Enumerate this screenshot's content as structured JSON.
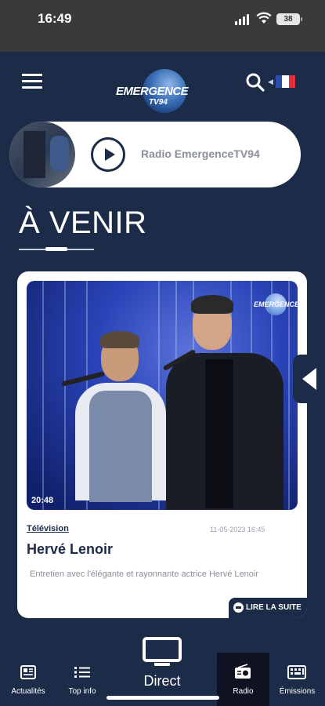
{
  "status_bar": {
    "time": "16:49",
    "battery": "38"
  },
  "header": {
    "logo_text": "EMERGENCE",
    "logo_sub": "TV94",
    "language_flag": "fr"
  },
  "radio": {
    "title": "Radio EmergenceTV94"
  },
  "section": {
    "title": "À VENIR"
  },
  "card": {
    "duration": "20:48",
    "category": "Télévision",
    "date": "11-05-2023 16:45",
    "title": "Hervé Lenoir",
    "description": "Entretien avec l'élégante et rayonnante actrice Hervé Lenoir",
    "read_more": "LIRE LA SUITE",
    "logo_text": "EMERGENCE"
  },
  "bottom_nav": {
    "items": [
      {
        "label": "Actualités",
        "icon": "news-icon"
      },
      {
        "label": "Top info",
        "icon": "list-icon"
      },
      {
        "label": "Direct",
        "icon": "tv-icon"
      },
      {
        "label": "Radio",
        "icon": "radio-icon"
      },
      {
        "label": "Émissions",
        "icon": "keyboard-icon"
      }
    ]
  },
  "colors": {
    "primary": "#1b2b48",
    "card_bg": "#ffffff",
    "active_nav": "#0f1220",
    "muted_text": "#8a8f98"
  }
}
